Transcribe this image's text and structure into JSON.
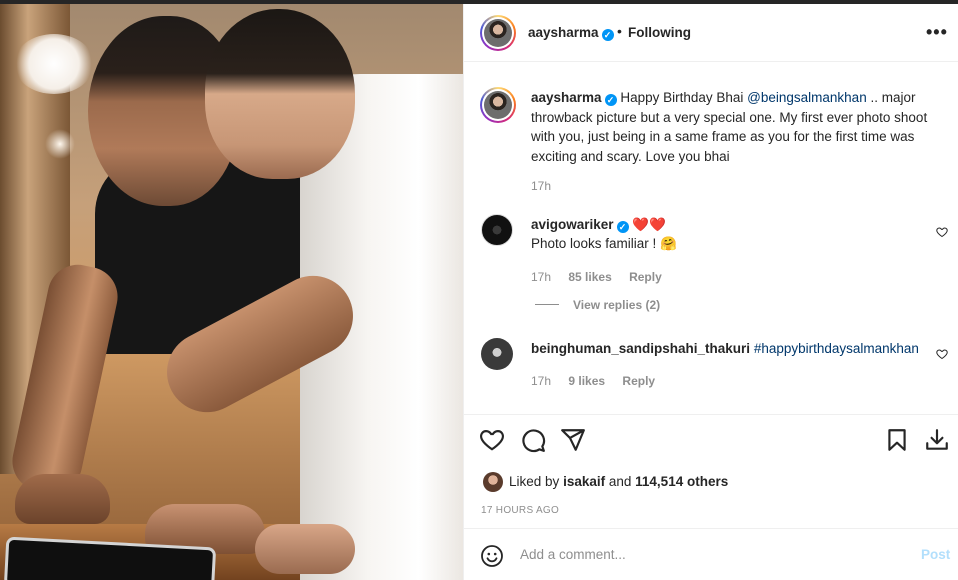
{
  "post": {
    "username": "aaysharma",
    "follow_status": "Following",
    "dot": "•",
    "more_label": "•••",
    "caption": {
      "username": "aaysharma",
      "text_before": "Happy Birthday Bhai",
      "mention": "@beingsalmankhan",
      "text_after": ".. major throwback picture but a very special one. My first ever photo shoot with you, just being in a same frame as you for the first time was exciting and scary. Love you bhai",
      "time": "17h"
    },
    "comments": [
      {
        "username": "avigowariker",
        "hearts": "❤️❤️",
        "text": "Photo looks familiar ! 🤗",
        "time": "17h",
        "likes": "85 likes",
        "reply": "Reply",
        "view_replies": "View replies (2)"
      },
      {
        "username": "beinghuman_sandipshahi_thakuri",
        "hashtag": "#happybirthdaysalmankhan",
        "time": "17h",
        "likes": "9 likes",
        "reply": "Reply"
      }
    ],
    "liked_by": {
      "prefix": "Liked by",
      "user": "isakaif",
      "and": "and",
      "others": "114,514 others"
    },
    "posted_ago": "17 HOURS AGO",
    "add_comment_placeholder": "Add a comment...",
    "post_label": "Post"
  },
  "icons": {
    "like": "heart-icon",
    "comment": "comment-icon",
    "share": "paper-plane-icon",
    "save": "bookmark-icon",
    "download": "download-icon",
    "emoji": "smiley-icon",
    "more": "more-icon",
    "verified": "verified-badge-icon"
  },
  "colors": {
    "verified": "#0095f6",
    "link": "#00376b",
    "muted": "#8e8e8e",
    "post_disabled": "#b2dffc"
  }
}
